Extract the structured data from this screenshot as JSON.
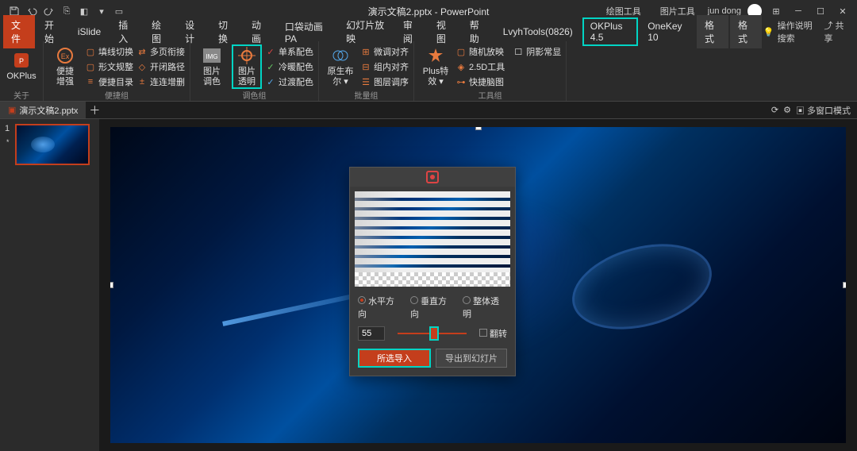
{
  "title": "演示文稿2.pptx - PowerPoint",
  "user": "jun dong",
  "context_tabs": {
    "draw_tools": "绘图工具",
    "pic_tools": "图片工具"
  },
  "tabs": {
    "file": "文件",
    "home": "开始",
    "islide": "iSlide",
    "insert": "插入",
    "draw": "绘图",
    "design": "设计",
    "transition": "切换",
    "anim": "动画",
    "pocket": "口袋动画 PA",
    "slideshow": "幻灯片放映",
    "review": "审阅",
    "view": "视图",
    "help": "帮助",
    "lvyh": "LvyhTools(0826)",
    "okplus": "OKPlus 4.5",
    "onekey": "OneKey 10",
    "format1": "格式",
    "format2": "格式",
    "tellme": "操作说明搜索",
    "share": "共享"
  },
  "ribbon": {
    "okplus_big": "OKPlus",
    "about": "关于",
    "bianjie": {
      "title": "便捷\n增强",
      "group": "便捷组"
    },
    "col1": {
      "a": "填线切换",
      "b": "形文规整",
      "c": "便捷目录"
    },
    "col2": {
      "a": "多页衔接",
      "b": "开闭路径",
      "c": "连连增删"
    },
    "tupian": {
      "tiaoSe": "图片\n调色",
      "touming": "图片\n透明",
      "group": "调色组"
    },
    "col3": {
      "a": "单系配色",
      "b": "冷暖配色",
      "c": "过渡配色"
    },
    "yuansheng": "原生布\n尔 ▾",
    "col4": {
      "a": "微调对齐",
      "b": "组内对齐",
      "c": "图层调序",
      "group": "批量组"
    },
    "plus": "Plus特\n效 ▾",
    "col5": {
      "a": "随机放映",
      "b": "2.5D工具",
      "c": "快捷脑图",
      "group": "工具组"
    },
    "yinying": "阴影常显"
  },
  "doc": {
    "name": "演示文稿2.pptx",
    "multi": "多窗口模式"
  },
  "thumb": {
    "num": "1",
    "star": "*"
  },
  "dialog": {
    "radio_h": "水平方向",
    "radio_v": "垂直方向",
    "radio_all": "整体透明",
    "value": "55",
    "flip": "翻转",
    "btn_import": "所选导入",
    "btn_export": "导出到幻灯片"
  }
}
